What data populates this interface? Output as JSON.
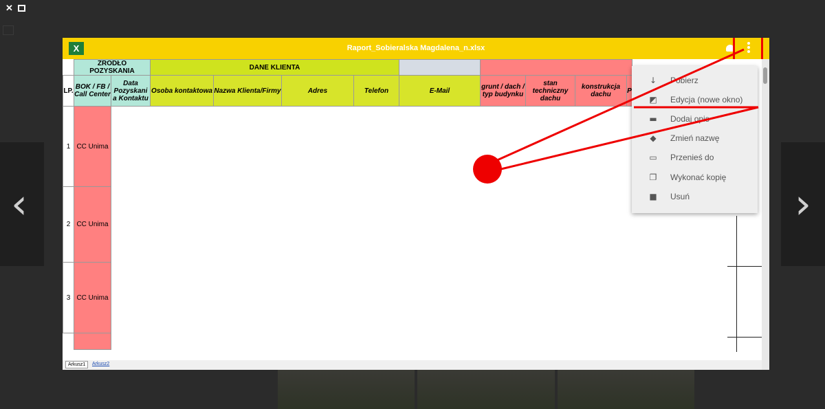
{
  "viewer_controls": {
    "close_glyph": "✕"
  },
  "document": {
    "title": "Raport_Sobieralska Magdalena_n.xlsx",
    "app_badge": "X"
  },
  "sheet": {
    "group_headers": {
      "source": "ZRODŁO POZYSKANIA",
      "client": "DANE KLIENTA"
    },
    "columns": {
      "lp": "LP.",
      "bok": "BOK / FB / Call Center",
      "date": "Data Pozyskani a Kontaktu",
      "contact": "Osoba kontaktowa",
      "client_name": "Nazwa Klienta/Firmy",
      "address": "Adres",
      "phone": "Telefon",
      "email": "E-Mail",
      "ground": "grunt / dach / typ budynku",
      "roof_state": "stan techniczny dachu",
      "roof_construction": "konstrukcja dachu",
      "next": "P"
    },
    "rows": [
      {
        "lp": "1",
        "source": "CC Unima"
      },
      {
        "lp": "2",
        "source": "CC Unima"
      },
      {
        "lp": "3",
        "source": "CC Unima"
      }
    ],
    "tabs": [
      "Arkusz1",
      "Arkusz2"
    ]
  },
  "menu": {
    "items": [
      {
        "label": "Pobierz",
        "icon": "download-icon"
      },
      {
        "label": "Edycja (nowe okno)",
        "icon": "edit-icon"
      },
      {
        "label": "Dodaj opis",
        "icon": "comment-icon"
      },
      {
        "label": "Zmień nazwę",
        "icon": "tag-icon"
      },
      {
        "label": "Przenieś do",
        "icon": "folder-icon"
      },
      {
        "label": "Wykonać kopię",
        "icon": "copy-icon"
      },
      {
        "label": "Usuń",
        "icon": "trash-icon"
      }
    ]
  },
  "colors": {
    "header": "#f8d100",
    "annotation": "#ee0000",
    "source_fill": "#ff8080",
    "client_fill": "#cfe31e"
  }
}
